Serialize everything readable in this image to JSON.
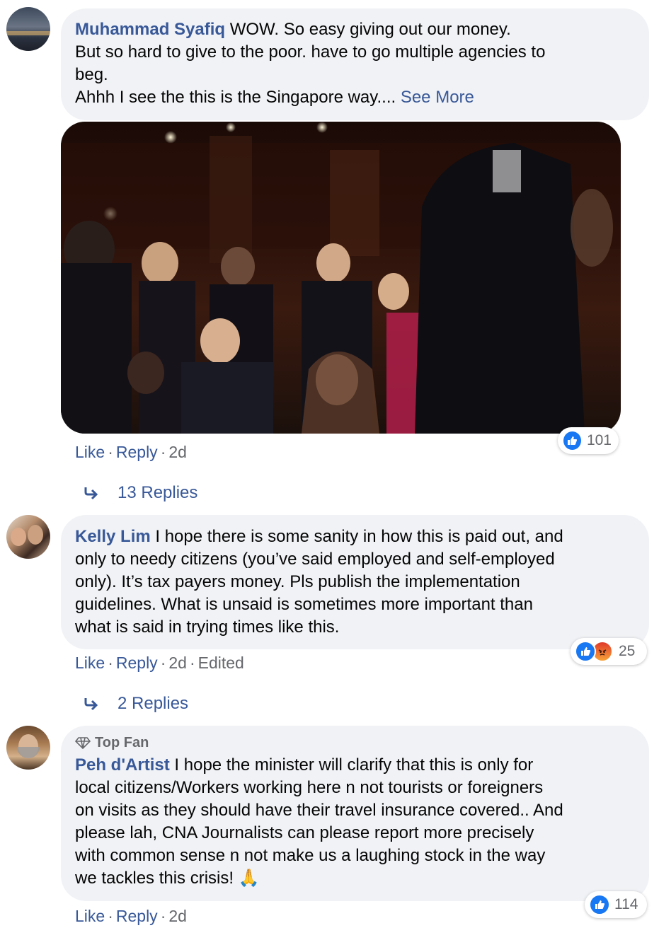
{
  "comments": [
    {
      "author": "Muhammad Syafiq",
      "lines": [
        "WOW. So easy giving out our money.",
        "But so hard to give to the poor. have to go multiple agencies to",
        "beg.",
        "Ahhh I see the this is the Singapore way...."
      ],
      "see_more": "See More",
      "actions": {
        "like": "Like",
        "reply": "Reply",
        "time": "2d"
      },
      "reaction_count": "101",
      "replies_label": "13 Replies"
    },
    {
      "author": "Kelly Lim",
      "lines": [
        "I hope there is some sanity in how this is paid out, and",
        "only to needy citizens (you’ve said employed and self-employed",
        "only). It’s tax payers money. Pls publish the implementation",
        "guidelines. What is unsaid is sometimes more important than",
        "what is said in trying times like this."
      ],
      "actions": {
        "like": "Like",
        "reply": "Reply",
        "time": "2d",
        "edited": "Edited"
      },
      "reaction_count": "25",
      "replies_label": "2 Replies"
    },
    {
      "badge": "Top Fan",
      "author": "Peh d'Artist",
      "lines": [
        "I hope the minister will clarify that this is only for",
        "local citizens/Workers working here n not tourists or foreigners",
        "on visits as they should have their travel insurance covered.. And",
        "please lah, CNA Journalists can please report more precisely",
        "with common sense n not make us a laughing stock in the way",
        "we tackles this crisis!"
      ],
      "emoji": "🙏",
      "actions": {
        "like": "Like",
        "reply": "Reply",
        "time": "2d"
      },
      "reaction_count": "114"
    }
  ],
  "colors": {
    "link": "#385898",
    "bubble": "#f0f2f5",
    "like_blue": "#1877f2",
    "angry_orange": "#f0692b"
  },
  "icons": [
    "like-reaction-icon",
    "angry-reaction-icon",
    "reply-arrow-icon",
    "diamond-icon",
    "gif-image"
  ]
}
